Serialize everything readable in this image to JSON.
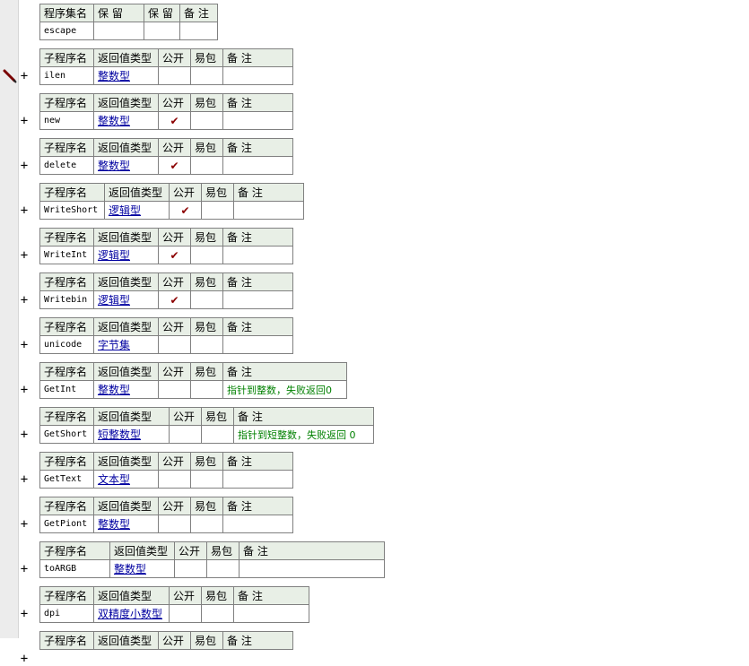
{
  "assembly": {
    "headers": [
      "程序集名",
      "保 留",
      "保 留",
      "备 注"
    ],
    "name": "escape"
  },
  "sub_headers": {
    "name": "子程序名",
    "return_type": "返回值类型",
    "public": "公开",
    "easy_pack": "易包",
    "note": "备 注"
  },
  "expand_icon": "+",
  "check_mark": "✔",
  "cursor_icon": "pencil-icon",
  "colors": {
    "header_bg": "#e8efe6",
    "type_link": "#0000a0",
    "note_text": "#008000",
    "check_mark": "#8b0000"
  },
  "subs": [
    {
      "name": "ilen",
      "type": "整数型",
      "public": false,
      "note": ""
    },
    {
      "name": "new",
      "type": "整数型",
      "public": true,
      "note": ""
    },
    {
      "name": "delete",
      "type": "整数型",
      "public": true,
      "note": ""
    },
    {
      "name": "WriteShort",
      "type": "逻辑型",
      "public": true,
      "note": ""
    },
    {
      "name": "WriteInt",
      "type": "逻辑型",
      "public": true,
      "note": ""
    },
    {
      "name": "Writebin",
      "type": "逻辑型",
      "public": true,
      "note": ""
    },
    {
      "name": "unicode",
      "type": "字节集",
      "public": false,
      "note": ""
    },
    {
      "name": "GetInt",
      "type": "整数型",
      "public": false,
      "note": "指针到整数，失败返回0"
    },
    {
      "name": "GetShort",
      "type": "短整数型",
      "public": false,
      "note": "指针到短整数，失败返回 0"
    },
    {
      "name": "GetText",
      "type": "文本型",
      "public": false,
      "note": ""
    },
    {
      "name": "GetPiont",
      "type": "整数型",
      "public": false,
      "note": ""
    },
    {
      "name": "toARGB",
      "type": "整数型",
      "public": false,
      "note": ""
    },
    {
      "name": "dpi",
      "type": "双精度小数型",
      "public": false,
      "note": ""
    }
  ]
}
